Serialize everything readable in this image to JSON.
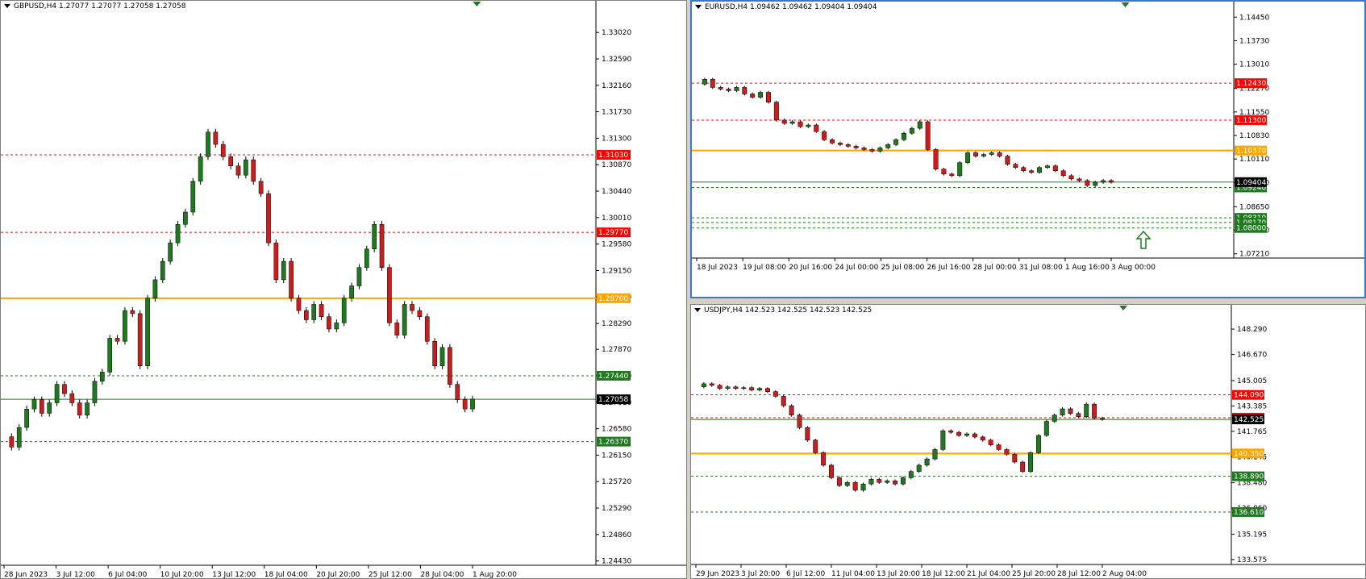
{
  "window": {
    "accent_border": "#3c78c8",
    "background": "#d4d0c8"
  },
  "colors": {
    "bull": "#1f7a1f",
    "bear": "#c81e1e",
    "wick": "#000000",
    "support": "#1f7a1f",
    "resistance": "#ff0000",
    "pivot": "#ffa500",
    "current": "#1f7a1f",
    "current_label_bg": "#000000"
  },
  "panes": [
    {
      "id": "gbp",
      "title": "GBPUSD,H4  1.27077 1.27077 1.27058 1.27058",
      "chart_data": {
        "type": "candlestick",
        "symbol": "GBPUSD",
        "timeframe": "H4",
        "ylim": [
          1.2436,
          1.3335
        ],
        "y_ticks": [
          "1.33020",
          "1.32590",
          "1.32160",
          "1.31730",
          "1.31300",
          "1.30870",
          "1.30440",
          "1.30010",
          "1.29580",
          "1.29150",
          "1.28720",
          "1.28290",
          "1.27870",
          "1.27440",
          "1.27010",
          "1.26580",
          "1.26150",
          "1.25720",
          "1.25290",
          "1.24860",
          "1.24430"
        ],
        "x_labels": [
          "28 Jun 2023",
          "3 Jul 12:00",
          "6 Jul 04:00",
          "10 Jul 20:00",
          "13 Jul 12:00",
          "18 Jul 04:00",
          "20 Jul 20:00",
          "25 Jul 12:00",
          "28 Jul 04:00",
          "1 Aug 20:00"
        ],
        "levels": [
          {
            "value": 1.3103,
            "label": "1.31030",
            "kind": "resistance"
          },
          {
            "value": 1.2977,
            "label": "1.29770",
            "kind": "resistance"
          },
          {
            "value": 1.287,
            "label": "1.28700",
            "kind": "pivot"
          },
          {
            "value": 1.2744,
            "label": "1.27440",
            "kind": "support"
          },
          {
            "value": 1.2637,
            "label": "1.26370",
            "kind": "support"
          }
        ],
        "current": {
          "value": 1.27058,
          "label": "1.27058"
        },
        "path": [
          1.2645,
          1.2628,
          1.266,
          1.269,
          1.2705,
          1.2683,
          1.27,
          1.273,
          1.2715,
          1.27,
          1.268,
          1.27,
          1.2735,
          1.275,
          1.2805,
          1.28,
          1.285,
          1.2845,
          1.276,
          1.287,
          1.29,
          1.293,
          1.296,
          1.299,
          1.301,
          1.306,
          1.31,
          1.314,
          1.312,
          1.31,
          1.3085,
          1.307,
          1.3095,
          1.306,
          1.304,
          1.296,
          1.29,
          1.293,
          1.287,
          1.285,
          1.2835,
          1.286,
          1.284,
          1.282,
          1.283,
          1.287,
          1.289,
          1.292,
          1.295,
          1.299,
          1.292,
          1.283,
          1.281,
          1.286,
          1.285,
          1.284,
          1.28,
          1.276,
          1.279,
          1.273,
          1.2705,
          1.269,
          1.2706
        ]
      }
    },
    {
      "id": "eur",
      "title": "EURUSD,H4  1.09462 1.09462 1.09404 1.09404",
      "chart_data": {
        "type": "candlestick",
        "symbol": "EURUSD",
        "timeframe": "H4",
        "ylim": [
          1.0708,
          1.1458
        ],
        "y_ticks": [
          "1.14450",
          "1.13730",
          "1.13010",
          "1.12270",
          "1.11550",
          "1.10830",
          "1.10110",
          "1.09390",
          "1.08650",
          "1.07930",
          "1.07210"
        ],
        "x_labels": [
          "18 Jul 2023",
          "19 Jul 08:00",
          "20 Jul 16:00",
          "24 Jul 00:00",
          "25 Jul 08:00",
          "26 Jul 16:00",
          "28 Jul 00:00",
          "31 Jul 08:00",
          "1 Aug 16:00",
          "3 Aug 00:00"
        ],
        "levels": [
          {
            "value": 1.1243,
            "label": "1.12430",
            "kind": "resistance"
          },
          {
            "value": 1.113,
            "label": "1.11300",
            "kind": "resistance"
          },
          {
            "value": 1.1037,
            "label": "1.10370",
            "kind": "pivot"
          },
          {
            "value": 1.0924,
            "label": "1.09240",
            "kind": "support"
          },
          {
            "value": 1.0831,
            "label": "1.08310",
            "kind": "support"
          },
          {
            "value": 1.0817,
            "label": "1.08170",
            "kind": "support"
          },
          {
            "value": 1.08,
            "label": "1.08000",
            "kind": "support"
          }
        ],
        "current": {
          "value": 1.09404,
          "label": "1.09404"
        },
        "arrow_icon": "up-arrow-icon",
        "path": [
          1.124,
          1.1255,
          1.123,
          1.1225,
          1.122,
          1.123,
          1.121,
          1.12,
          1.1215,
          1.1185,
          1.113,
          1.112,
          1.1125,
          1.111,
          1.1115,
          1.1095,
          1.107,
          1.106,
          1.1055,
          1.105,
          1.1045,
          1.104,
          1.1035,
          1.1045,
          1.1055,
          1.107,
          1.109,
          1.1105,
          1.1125,
          1.104,
          1.098,
          1.0965,
          1.096,
          1.1,
          1.103,
          1.102,
          1.1025,
          1.103,
          1.102,
          1.0995,
          1.0985,
          1.0975,
          1.097,
          1.0985,
          1.099,
          1.0975,
          1.096,
          1.095,
          1.0945,
          1.093,
          1.094,
          1.0945,
          1.094
        ]
      }
    },
    {
      "id": "jpy",
      "title": "USDJPY,H4  142.523 142.525 142.523 142.525",
      "chart_data": {
        "type": "candlestick",
        "symbol": "USDJPY",
        "timeframe": "H4",
        "ylim": [
          133.26,
          149.12
        ],
        "y_ticks": [
          "148.290",
          "146.670",
          "145.005",
          "143.385",
          "141.765",
          "140.145",
          "138.480",
          "136.860",
          "135.195",
          "133.575"
        ],
        "x_labels": [
          "29 Jun 2023",
          "3 Jul 20:00",
          "6 Jul 12:00",
          "11 Jul 04:00",
          "13 Jul 20:00",
          "18 Jul 12:00",
          "21 Jul 04:00",
          "25 Jul 20:00",
          "28 Jul 12:00",
          "2 Aug 04:00"
        ],
        "levels": [
          {
            "value": 144.09,
            "label": "144.090",
            "kind": "resistance"
          },
          {
            "value": 142.63,
            "label": "142.630",
            "kind": "resistance"
          },
          {
            "value": 140.35,
            "label": "140.350",
            "kind": "pivot"
          },
          {
            "value": 138.89,
            "label": "138.890",
            "kind": "support"
          },
          {
            "value": 136.61,
            "label": "136.610",
            "kind": "support"
          }
        ],
        "current": {
          "value": 142.525,
          "label": "142.525"
        },
        "path": [
          144.6,
          144.8,
          144.7,
          144.5,
          144.6,
          144.5,
          144.55,
          144.4,
          144.5,
          144.3,
          144.0,
          143.4,
          142.8,
          142.0,
          141.2,
          140.4,
          139.6,
          138.8,
          138.3,
          138.5,
          138.0,
          138.4,
          138.7,
          138.5,
          138.6,
          138.4,
          138.8,
          139.2,
          139.6,
          140.0,
          140.6,
          141.8,
          141.7,
          141.5,
          141.6,
          141.4,
          141.2,
          140.9,
          140.6,
          140.3,
          139.8,
          139.2,
          140.4,
          141.5,
          142.4,
          142.8,
          143.2,
          142.9,
          142.7,
          143.5,
          142.6,
          142.525
        ]
      }
    }
  ]
}
